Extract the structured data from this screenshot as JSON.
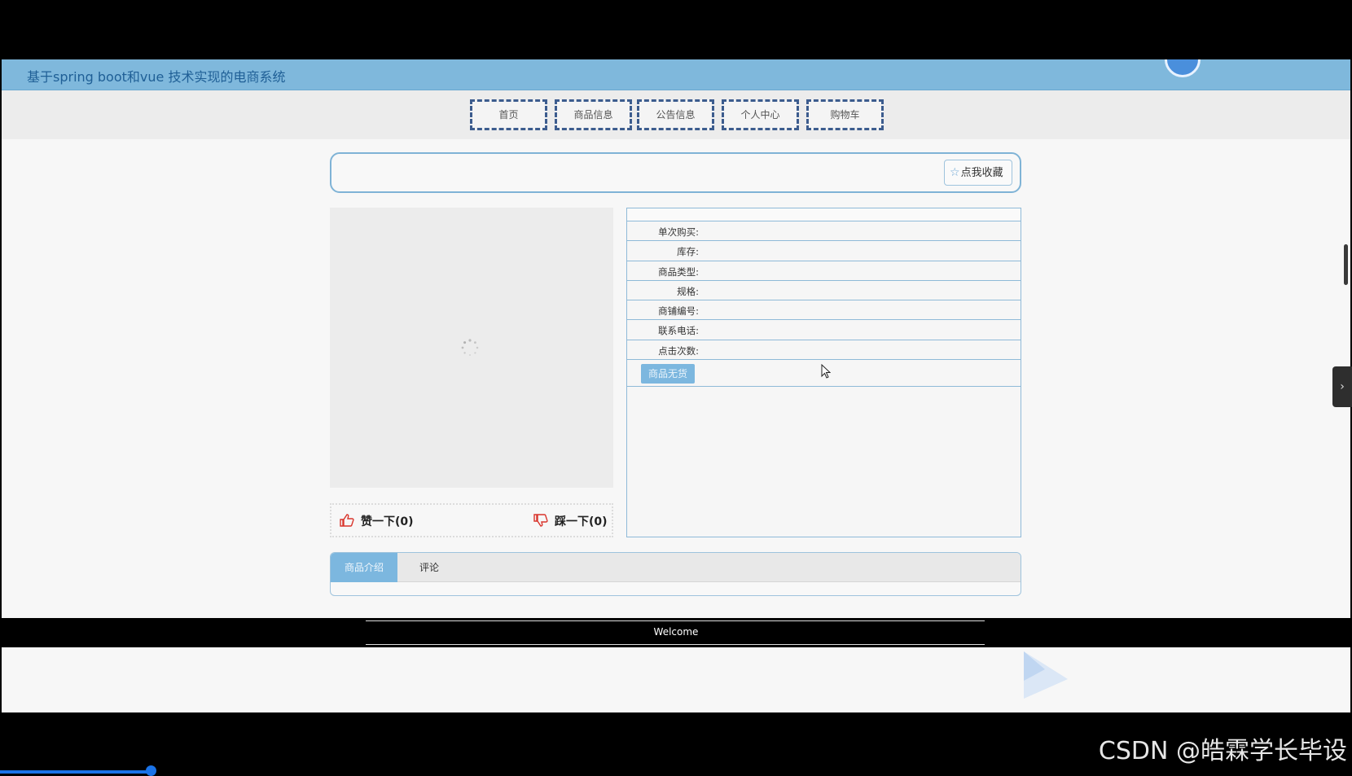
{
  "app": {
    "title": "基于spring boot和vue 技术实现的电商系统"
  },
  "nav": {
    "items": [
      "首页",
      "商品信息",
      "公告信息",
      "个人中心",
      "购物车"
    ]
  },
  "product": {
    "favorite_label": "点我收藏",
    "fields": [
      "单次购买:",
      "库存:",
      "商品类型:",
      "规格:",
      "商铺编号:",
      "联系电话:",
      "点击次数:"
    ],
    "out_of_stock_label": "商品无货"
  },
  "votes": {
    "like": "赞一下(0)",
    "dislike": "踩一下(0)"
  },
  "tabs": {
    "intro": "商品介绍",
    "comments": "评论"
  },
  "footer": {
    "text": "Welcome"
  },
  "watermark": {
    "text": "CSDN @皓霖学长毕设"
  },
  "colors": {
    "accent": "#7cb7df",
    "header": "#7fb8dc",
    "nav_border": "#3c5c8e"
  }
}
